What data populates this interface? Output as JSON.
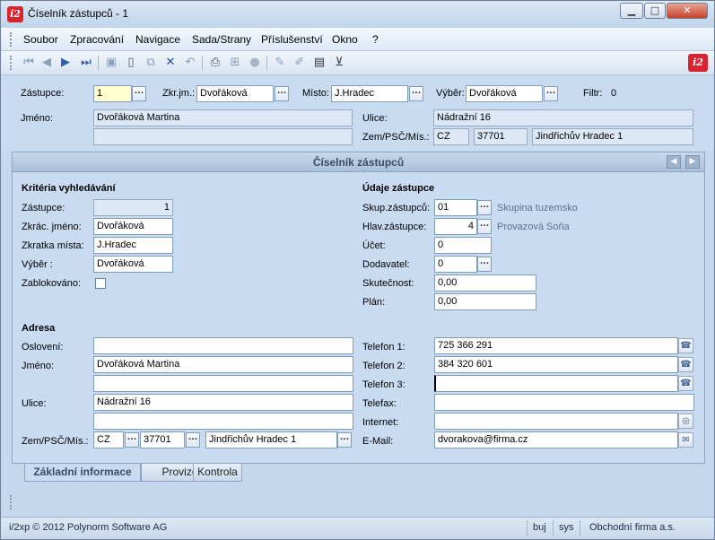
{
  "window": {
    "title": "Číselník zástupců - 1",
    "logo": "i2"
  },
  "menu": [
    "Soubor",
    "Zpracování",
    "Navigace",
    "Sada/Strany",
    "Příslušenství",
    "Okno",
    "?"
  ],
  "toolbar": {
    "icons": [
      "first-record-icon",
      "previous-record-icon",
      "next-record-icon",
      "last-record-icon",
      "save-icon",
      "new-record-icon",
      "copy-record-icon",
      "delete-icon",
      "undo-icon",
      "print-icon",
      "tree-icon",
      "disabled-round-icon",
      "edit-pen-icon",
      "edit-pen2-icon",
      "report-icon",
      "filter-icon"
    ]
  },
  "header": {
    "zastupce_label": "Zástupce:",
    "zastupce_value": "1",
    "zkrjm_label": "Zkr.jm.:",
    "zkrjm_value": "Dvořáková",
    "misto_label": "Místo:",
    "misto_value": "J.Hradec",
    "vyber_label": "Výběr:",
    "vyber_value": "Dvořáková",
    "filtr_label": "Filtr:",
    "filtr_value": "0",
    "jmeno_label": "Jméno:",
    "jmeno_value": "Dvořáková Martina",
    "jmeno2_value": "",
    "ulice_label": "Ulice:",
    "ulice_value": "Nádražní 16",
    "zem_label": "Zem/PSČ/Mís.:",
    "zem_value": "CZ",
    "psc_value": "37701",
    "mesto_value": "Jindřichův Hradec 1"
  },
  "panel": {
    "title": "Číselník zástupců",
    "criteria": {
      "heading": "Kritéria vyhledávání",
      "zastupce_label": "Zástupce:",
      "zastupce_value": "1",
      "zkrac_label": "Zkrác. jméno:",
      "zkrac_value": "Dvořáková",
      "zkratka_label": "Zkratka místa:",
      "zkratka_value": "J.Hradec",
      "vyber_label": "Výběr :",
      "vyber_value": "Dvořáková",
      "zablok_label": "Zablokováno:",
      "zablok_checked": false
    },
    "udaje": {
      "heading": "Údaje zástupce",
      "skup_label": "Skup.zástupců:",
      "skup_value": "01",
      "skup_desc": "Skupina tuzemsko",
      "hlav_label": "Hlav.zástupce:",
      "hlav_value": "4",
      "hlav_desc": "Provazová Soňa",
      "ucet_label": "Účet:",
      "ucet_value": "0",
      "dodav_label": "Dodavatel:",
      "dodav_value": "0",
      "skut_label": "Skutečnost:",
      "skut_value": "0,00",
      "plan_label": "Plán:",
      "plan_value": "0,00"
    },
    "adresa": {
      "heading": "Adresa",
      "osloveni_label": "Oslovení:",
      "osloveni_value": "",
      "jmeno_label": "Jméno:",
      "jmeno_value": "Dvořáková Martina",
      "jmeno2_value": "",
      "ulice_label": "Ulice:",
      "ulice_value": "Nádražní 16",
      "ulice2_value": "",
      "zem_label": "Zem/PSČ/Mís.:",
      "zem_value": "CZ",
      "psc_value": "37701",
      "mesto_value": "Jindřichův Hradec 1"
    },
    "kontakt": {
      "tel1_label": "Telefon 1:",
      "tel1_value": "725 366 291",
      "tel2_label": "Telefon 2:",
      "tel2_value": "384 320 601",
      "tel3_label": "Telefon 3:",
      "tel3_value": "",
      "fax_label": "Telefax:",
      "fax_value": "",
      "internet_label": "Internet:",
      "internet_value": "",
      "email_label": "E-Mail:",
      "email_value": "dvorakova@firma.cz"
    }
  },
  "tabs": [
    "Základní informace",
    "Provize",
    "Kontrola"
  ],
  "status": {
    "copyright": "i/2xp © 2012 Polynorm Software AG",
    "user": "buj",
    "db": "sys",
    "company": "Obchodní firma a.s."
  }
}
